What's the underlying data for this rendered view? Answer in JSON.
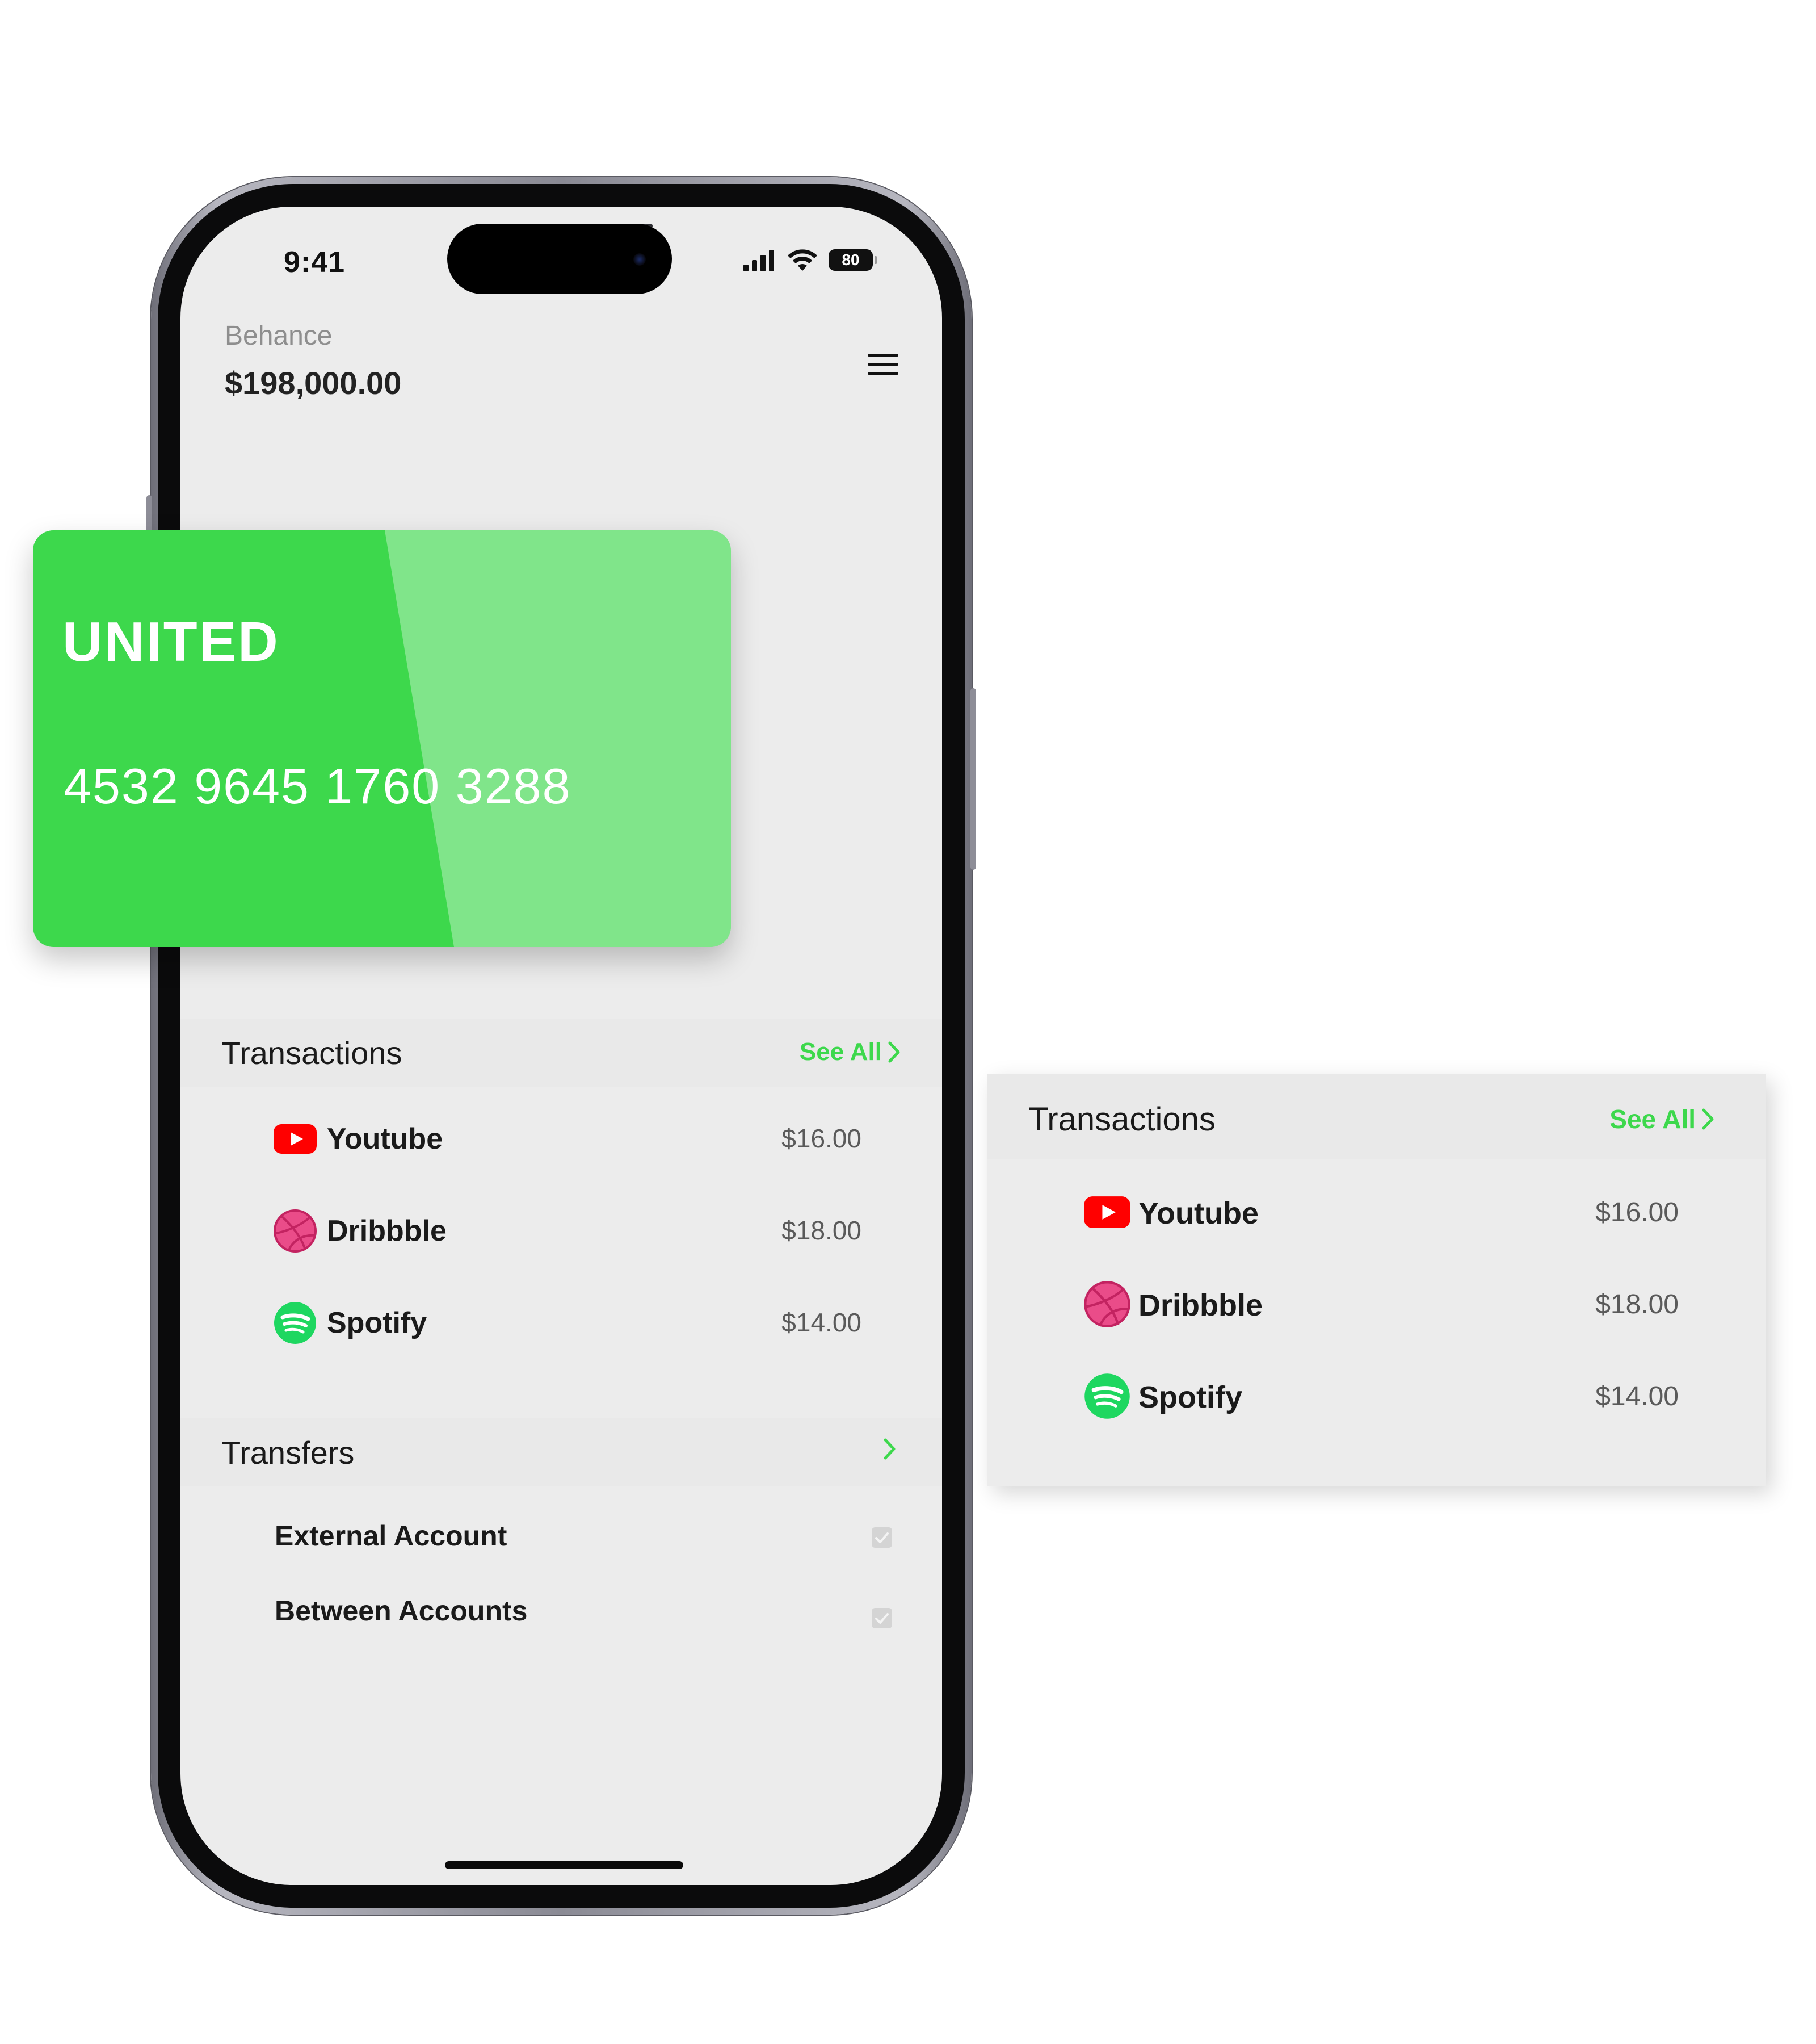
{
  "status_bar": {
    "time": "9:41",
    "battery": "80"
  },
  "account": {
    "name": "Behance",
    "balance": "$198,000.00"
  },
  "card": {
    "brand": "UNITED",
    "number": "4532 9645 1760 3288",
    "color": "#3dd84c"
  },
  "transactions": {
    "title": "Transactions",
    "see_all": "See All",
    "items": [
      {
        "name": "Youtube",
        "amount": "$16.00",
        "icon": "youtube-icon"
      },
      {
        "name": "Dribbble",
        "amount": "$18.00",
        "icon": "dribbble-icon"
      },
      {
        "name": "Spotify",
        "amount": "$14.00",
        "icon": "spotify-icon"
      }
    ]
  },
  "transfers": {
    "title": "Transfers",
    "items": [
      {
        "label": "External Account",
        "checked": true
      },
      {
        "label": "Between Accounts",
        "checked": true
      }
    ]
  },
  "colors": {
    "accent": "#3dd84c",
    "youtube": "#ff0000",
    "dribbble": "#ea4c89",
    "spotify": "#1ed760"
  }
}
